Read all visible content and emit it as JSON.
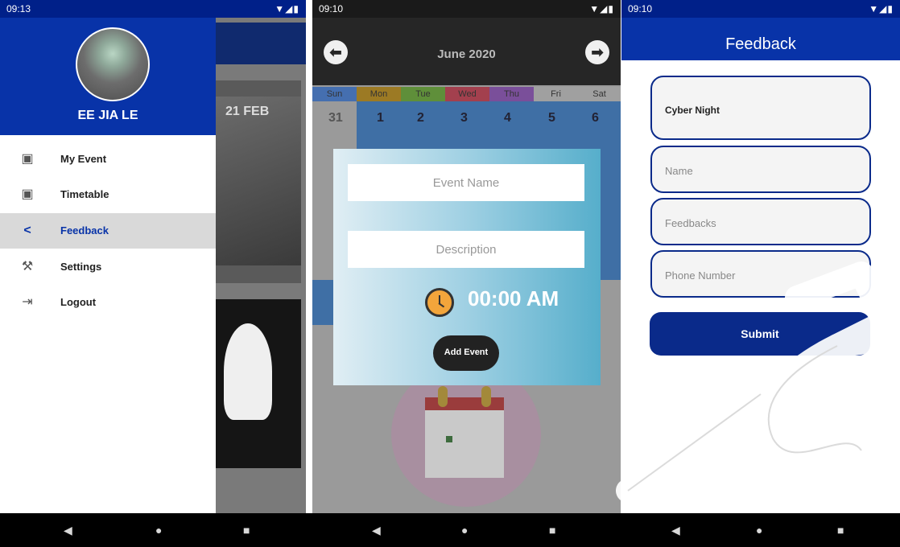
{
  "panel1": {
    "status_time": "09:13",
    "status_icons": "▼◢▮",
    "user_name": "EE JIA LE",
    "menu": [
      {
        "label": "My Event",
        "icon": "image-icon"
      },
      {
        "label": "Timetable",
        "icon": "image-icon"
      },
      {
        "label": "Feedback",
        "icon": "share-icon",
        "active": true
      },
      {
        "label": "Settings",
        "icon": "wrench-icon"
      },
      {
        "label": "Logout",
        "icon": "logout-icon"
      }
    ],
    "bg_card_text": "21 FEB"
  },
  "panel2": {
    "status_time": "09:10",
    "status_icons": "▼◢▮",
    "month": "June 2020",
    "weekdays": [
      "Sun",
      "Mon",
      "Tue",
      "Wed",
      "Thu",
      "Fri",
      "Sat"
    ],
    "first_row": [
      "31",
      "1",
      "2",
      "3",
      "4",
      "5",
      "6"
    ],
    "dialog": {
      "event_name_placeholder": "Event Name",
      "description_placeholder": "Description",
      "time": "00:00 AM",
      "add_button": "Add Event"
    }
  },
  "panel3": {
    "status_time": "09:10",
    "status_icons": "▼◢▮",
    "title": "Feedback",
    "event_value": "Cyber Night",
    "name_placeholder": "Name",
    "feedback_placeholder": "Feedbacks",
    "phone_placeholder": "Phone Number",
    "submit": "Submit"
  },
  "colors": {
    "primary": "#0833a8",
    "dark_blue": "#0a2a8a",
    "drawer_active": "#d9d9d9",
    "calendar_bar": "#262626"
  }
}
